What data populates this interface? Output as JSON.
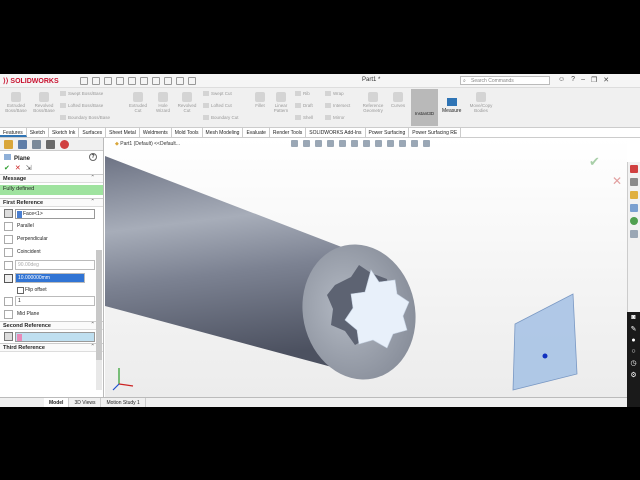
{
  "app": {
    "logo": "SOLIDWORKS",
    "doc_title": "Part1 *",
    "search_placeholder": "Search Commands"
  },
  "commands": {
    "extruded_boss": "Extruded Boss/Base",
    "revolved_boss": "Revolved Boss/Base",
    "swept_boss": "Swept Boss/Base",
    "lofted_boss": "Lofted Boss/Base",
    "boundary_boss": "Boundary Boss/Base",
    "extruded_cut": "Extruded Cut",
    "hole_wizard": "Hole Wizard",
    "revolved_cut": "Revolved Cut",
    "swept_cut": "Swept Cut",
    "lofted_cut": "Lofted Cut",
    "boundary_cut": "Boundary Cut",
    "fillet": "Fillet",
    "linear_pattern": "Linear Pattern",
    "rib": "Rib",
    "draft": "Draft",
    "shell": "Shell",
    "wrap": "Wrap",
    "intersect": "Intersect",
    "mirror": "Mirror",
    "ref_geometry": "Reference Geometry",
    "curves": "Curves",
    "instant3d": "Instant3D",
    "measure": "Measure",
    "move_copy": "Move/Copy Bodies"
  },
  "tabs": [
    "Features",
    "Sketch",
    "Sketch Ink",
    "Surfaces",
    "Sheet Metal",
    "Weldments",
    "Mold Tools",
    "Mesh Modeling",
    "Evaluate",
    "Render Tools",
    "SOLIDWORKS Add-Ins",
    "Power Surfacing",
    "Power Surfacing RE"
  ],
  "panel": {
    "title": "Plane",
    "message_header": "Message",
    "message": "Fully defined",
    "first_ref_header": "First Reference",
    "first_ref_value": "Face<1>",
    "parallel": "Parallel",
    "perpendicular": "Perpendicular",
    "coincident": "Coincident",
    "angle": "90.00deg",
    "distance": "10.000000mm",
    "flip_offset": "Flip offset",
    "count": "1",
    "mid_plane": "Mid Plane",
    "second_ref_header": "Second Reference",
    "third_ref_header": "Third Reference"
  },
  "viewport": {
    "breadcrumb": "Part1 (Default) <<Default..."
  },
  "bottom_tabs": [
    "Model",
    "3D Views",
    "Motion Study 1"
  ]
}
